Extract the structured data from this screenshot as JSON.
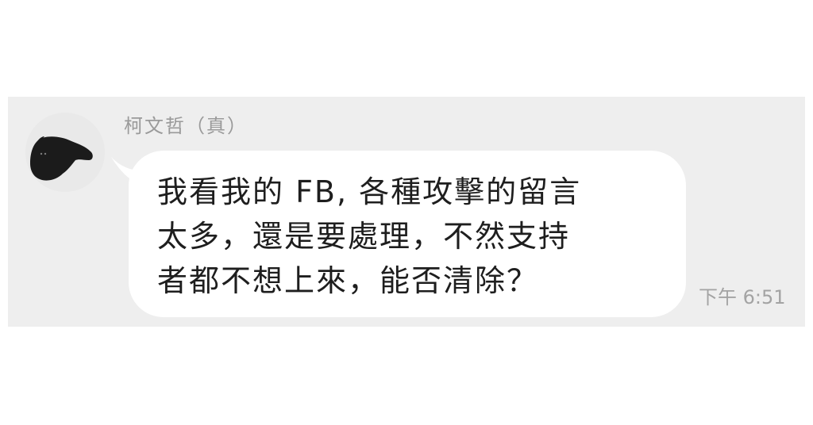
{
  "chat": {
    "sender_name": "柯文哲（真）",
    "message": "我看我的 FB, 各種攻擊的留言\n太多，還是要處理，不然支持\n者都不想上來，能否清除？",
    "time": "下午 6:51",
    "avatar_icon": "black-tapir-avatar-icon"
  },
  "colors": {
    "panel_background": "#eeeeee",
    "bubble_background": "#ffffff",
    "message_text": "#1e1e1e",
    "meta_text": "#9a9a9a"
  }
}
